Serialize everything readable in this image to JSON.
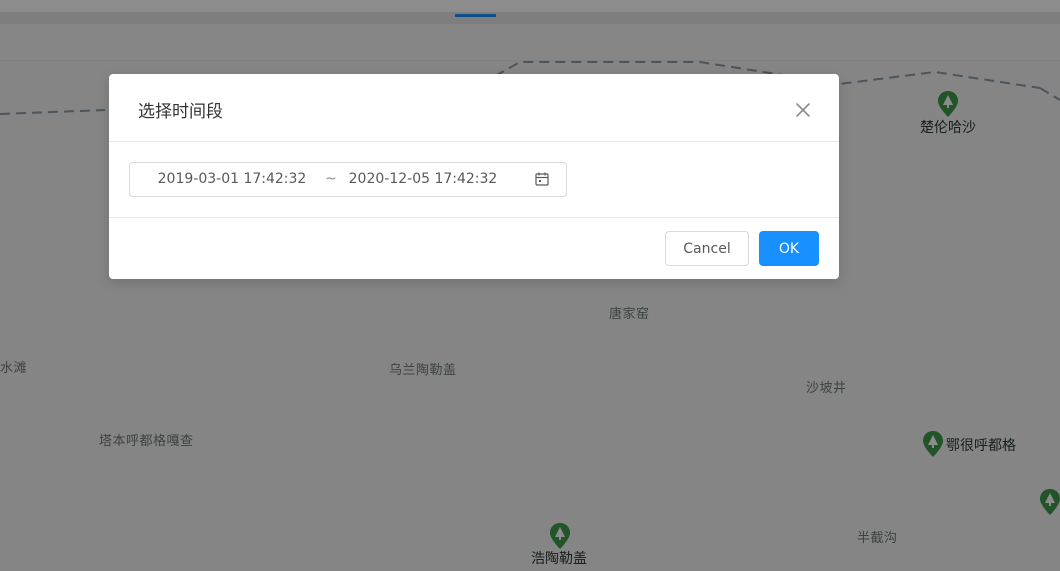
{
  "map": {
    "places": [
      {
        "name": "唐家窑"
      },
      {
        "name": "水滩"
      },
      {
        "name": "乌兰陶勒盖"
      },
      {
        "name": "沙坡井"
      },
      {
        "name": "塔本呼都格嘎查"
      },
      {
        "name": "半截沟"
      }
    ],
    "parks": [
      {
        "name": "楚伦哈沙",
        "icon": "park-pin-icon"
      },
      {
        "name": "鄂很呼都格",
        "icon": "park-pin-icon"
      },
      {
        "name": "浩陶勒盖",
        "icon": "park-pin-icon"
      }
    ],
    "colors": {
      "pin": "#3f9a4d",
      "place_text": "#6f7b73",
      "boundary": "#8a9aa8"
    }
  },
  "modal": {
    "title": "选择时间段",
    "close_icon": "close-icon",
    "range_picker": {
      "start": "2019-03-01 17:42:32",
      "separator": "~",
      "end": "2020-12-05 17:42:32",
      "icon": "calendar-icon"
    },
    "cancel_label": "Cancel",
    "ok_label": "OK"
  },
  "colors": {
    "primary": "#1890ff",
    "mask": "rgba(0,0,0,0.45)"
  }
}
